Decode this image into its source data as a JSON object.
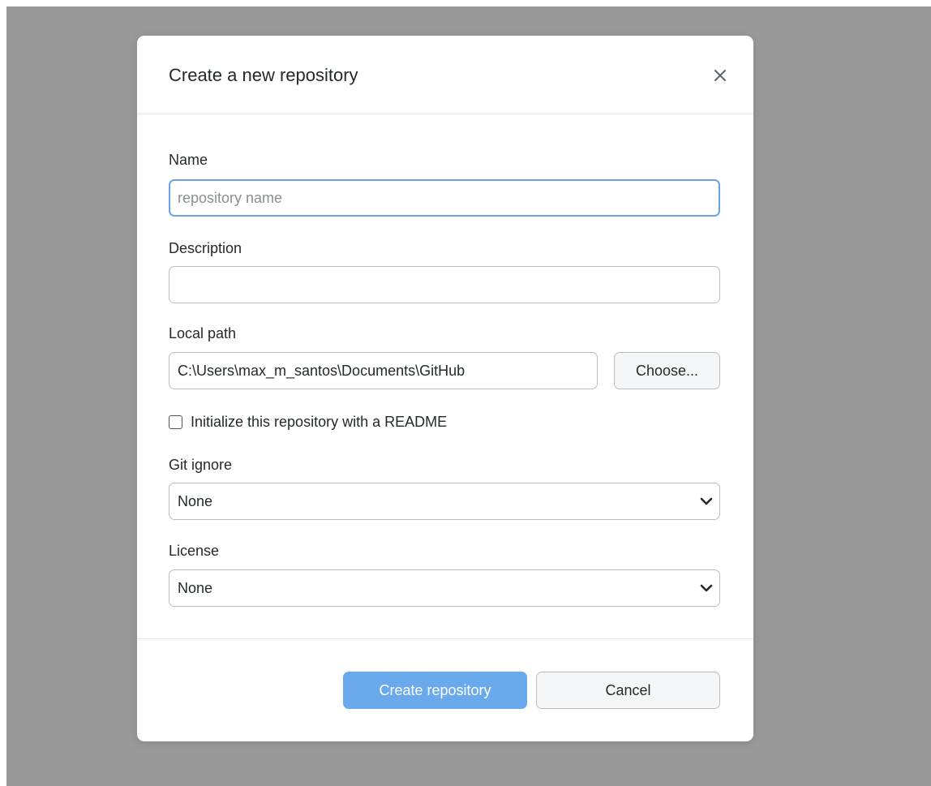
{
  "dialog": {
    "title": "Create a new repository",
    "close_icon": "close-icon"
  },
  "form": {
    "name": {
      "label": "Name",
      "value": "",
      "placeholder": "repository name"
    },
    "description": {
      "label": "Description",
      "value": "",
      "placeholder": ""
    },
    "local_path": {
      "label": "Local path",
      "value": "C:\\Users\\max_m_santos\\Documents\\GitHub",
      "choose_label": "Choose..."
    },
    "readme": {
      "label": "Initialize this repository with a README",
      "checked": false
    },
    "git_ignore": {
      "label": "Git ignore",
      "selected": "None"
    },
    "license": {
      "label": "License",
      "selected": "None"
    }
  },
  "footer": {
    "create_label": "Create repository",
    "cancel_label": "Cancel"
  },
  "colors": {
    "backdrop": "#999999",
    "primary_button": "#6aa9ec",
    "focus_border": "#6aa3e6"
  }
}
